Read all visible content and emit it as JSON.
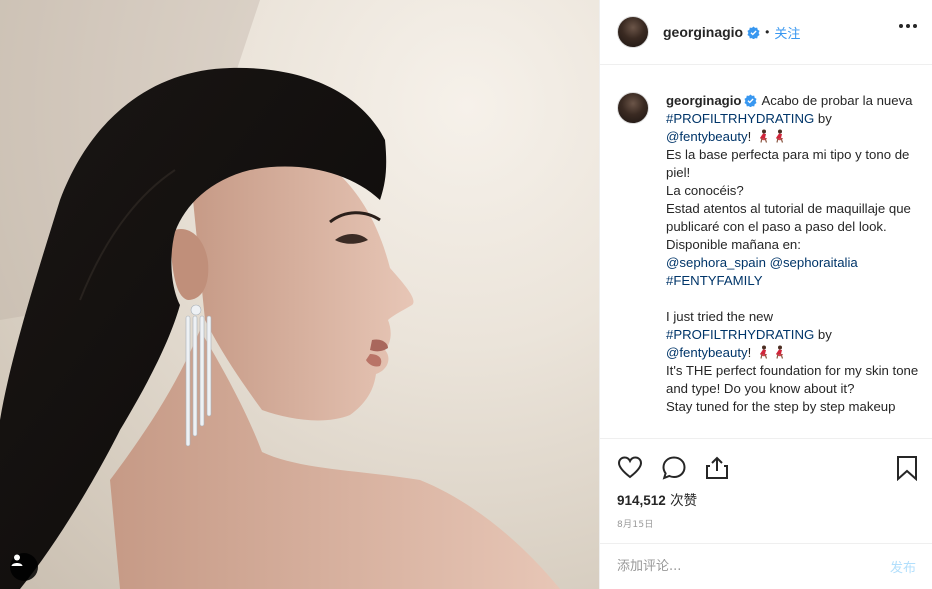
{
  "post": {
    "photo_alt": "profile portrait",
    "header": {
      "username": "georginagio",
      "dot": "•",
      "follow_label": "关注",
      "more_icon": "more-horizontal-icon"
    },
    "caption": {
      "username": "georginagio",
      "lines": [
        {
          "parts": [
            {
              "t": "Acabo de probar la nueva "
            },
            {
              "t": "#PROFILTRHYDRATING",
              "link": true
            },
            {
              "t": " by "
            }
          ]
        },
        {
          "parts": [
            {
              "t": "@fentybeauty",
              "link": true
            },
            {
              "t": "! "
            }
          ],
          "emoji": "dancer-emoji"
        },
        {
          "parts": [
            {
              "t": "Es la base perfecta para mi tipo y tono de piel!"
            }
          ]
        },
        {
          "parts": [
            {
              "t": "La conocéis?"
            }
          ]
        },
        {
          "parts": [
            {
              "t": "Estad atentos al tutorial de maquillaje que publicaré con el paso a paso del look."
            }
          ]
        },
        {
          "parts": [
            {
              "t": "Disponible mañana en:"
            }
          ]
        },
        {
          "parts": [
            {
              "t": "@sephora_spain",
              "link": true
            },
            {
              "t": " "
            },
            {
              "t": "@sephoraitalia",
              "link": true
            }
          ]
        },
        {
          "parts": [
            {
              "t": "#FENTYFAMILY",
              "link": true
            }
          ]
        },
        {
          "parts": [
            {
              "t": " "
            }
          ]
        },
        {
          "parts": [
            {
              "t": "I just tried the new"
            }
          ]
        },
        {
          "parts": [
            {
              "t": "#PROFILTRHYDRATING",
              "link": true
            },
            {
              "t": " by"
            }
          ]
        },
        {
          "parts": [
            {
              "t": "@fentybeauty",
              "link": true
            },
            {
              "t": "! "
            }
          ],
          "emoji": "dancer-emoji"
        },
        {
          "parts": [
            {
              "t": "It's THE perfect foundation for my skin tone and type! Do you know about it?"
            }
          ]
        },
        {
          "parts": [
            {
              "t": "Stay tuned for the step by step makeup"
            }
          ]
        }
      ]
    },
    "actions": {
      "like_icon": "heart-icon",
      "comment_icon": "comment-icon",
      "share_icon": "share-icon",
      "save_icon": "bookmark-icon"
    },
    "likes": {
      "count": "914,512",
      "suffix": " 次赞"
    },
    "date": "8月15日",
    "comment": {
      "placeholder": "添加评论...",
      "post_label": "发布"
    },
    "colors": {
      "link": "#003569",
      "verified": "#3897f0",
      "follow": "#3897f0",
      "post_disabled": "#b2dffc"
    }
  }
}
